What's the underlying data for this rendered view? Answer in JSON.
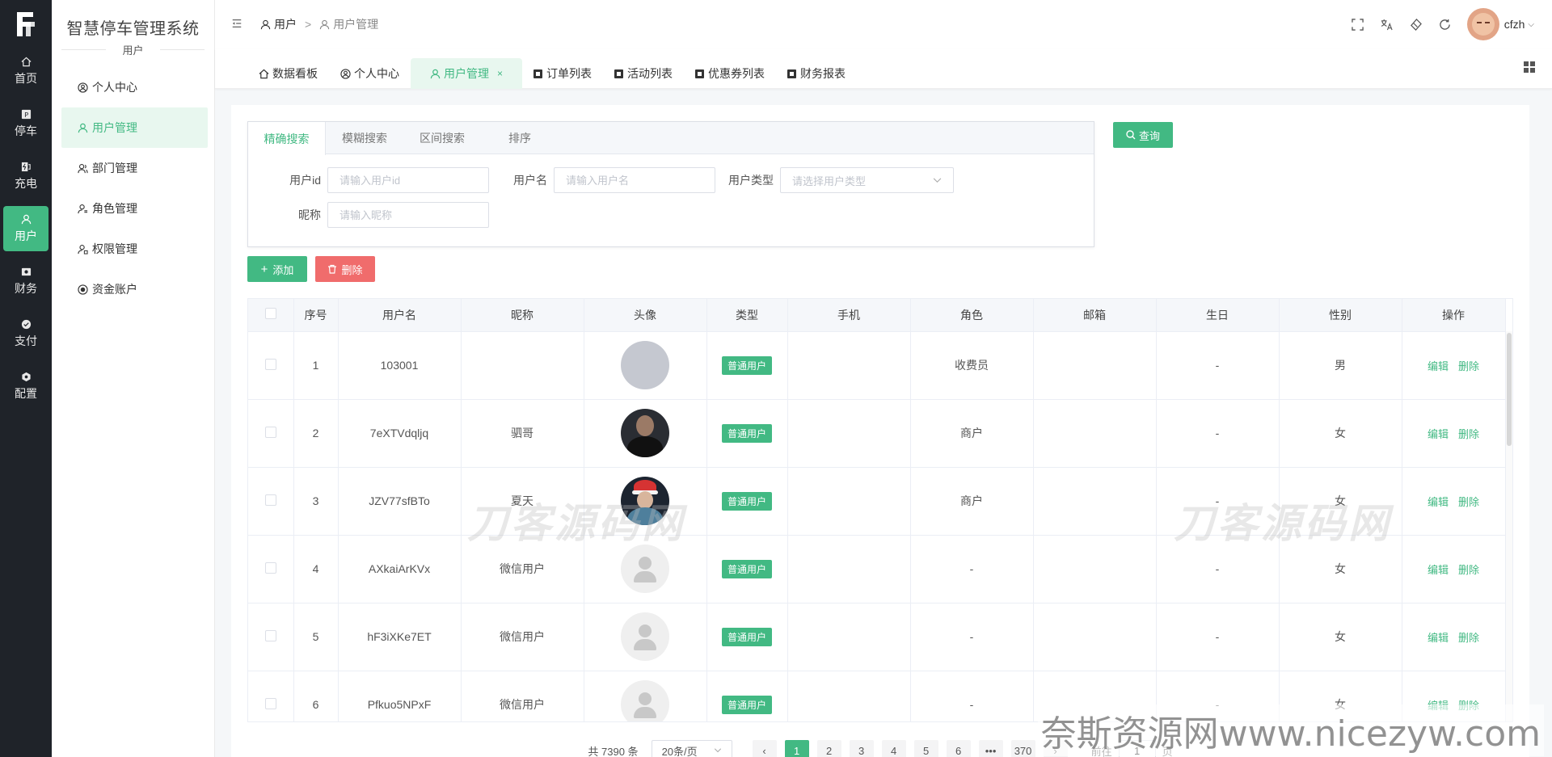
{
  "rail": {
    "items": [
      {
        "label": "首页",
        "icon": "home-icon"
      },
      {
        "label": "停车",
        "icon": "parking-icon"
      },
      {
        "label": "充电",
        "icon": "charge-icon"
      },
      {
        "label": "用户",
        "icon": "user-icon"
      },
      {
        "label": "财务",
        "icon": "finance-icon"
      },
      {
        "label": "支付",
        "icon": "pay-icon"
      },
      {
        "label": "配置",
        "icon": "config-icon"
      }
    ],
    "active": "用户"
  },
  "submenu": {
    "title": "智慧停车管理系统",
    "subtitle": "用户",
    "items": [
      {
        "label": "个人中心",
        "icon": "person-center-icon"
      },
      {
        "label": "用户管理",
        "icon": "user-icon"
      },
      {
        "label": "部门管理",
        "icon": "department-icon"
      },
      {
        "label": "角色管理",
        "icon": "role-icon"
      },
      {
        "label": "权限管理",
        "icon": "permission-icon"
      },
      {
        "label": "资金账户",
        "icon": "account-icon"
      }
    ],
    "active": "用户管理"
  },
  "breadcrumb": {
    "level1": "用户",
    "separator": ">",
    "level2": "用户管理"
  },
  "header": {
    "username": "cfzh"
  },
  "tabs": [
    {
      "label": "数据看板",
      "icon": "home-icon"
    },
    {
      "label": "个人中心",
      "icon": "person-center-icon"
    },
    {
      "label": "用户管理",
      "icon": "user-icon",
      "active": true,
      "close": "×"
    },
    {
      "label": "订单列表",
      "icon": "doc-icon"
    },
    {
      "label": "活动列表",
      "icon": "doc-icon"
    },
    {
      "label": "优惠券列表",
      "icon": "doc-icon"
    },
    {
      "label": "财务报表",
      "icon": "doc-icon"
    }
  ],
  "search": {
    "tabs": [
      "精确搜索",
      "模糊搜索",
      "区间搜索",
      "排序"
    ],
    "fields": {
      "user_id": {
        "label": "用户id",
        "placeholder": "请输入用户id",
        "value": ""
      },
      "username": {
        "label": "用户名",
        "placeholder": "请输入用户名",
        "value": ""
      },
      "user_type": {
        "label": "用户类型",
        "placeholder": "请选择用户类型"
      },
      "nickname": {
        "label": "昵称",
        "placeholder": "请输入昵称",
        "value": ""
      }
    },
    "query_label": "查询"
  },
  "actions": {
    "add_label": "添加",
    "delete_label": "删除"
  },
  "table": {
    "headers": [
      "",
      "序号",
      "用户名",
      "昵称",
      "头像",
      "类型",
      "手机",
      "角色",
      "邮箱",
      "生日",
      "性别",
      "操作"
    ],
    "edit_label": "编辑",
    "delete_label": "删除",
    "rows": [
      {
        "no": "1",
        "username": "103001",
        "nickname": "",
        "avatar": "grey",
        "type": "普通用户",
        "phone": "",
        "role": "收费员",
        "email": "",
        "birthday": "-",
        "gender": "男"
      },
      {
        "no": "2",
        "username": "7eXTVdqljq",
        "nickname": "驷哥",
        "avatar": "dark",
        "type": "普通用户",
        "phone": "",
        "role": "商户",
        "email": "",
        "birthday": "-",
        "gender": "女"
      },
      {
        "no": "3",
        "username": "JZV77sfBTo",
        "nickname": "夏天",
        "avatar": "xmas",
        "type": "普通用户",
        "phone": "",
        "role": "商户",
        "email": "",
        "birthday": "-",
        "gender": "女"
      },
      {
        "no": "4",
        "username": "AXkaiArKVx",
        "nickname": "微信用户",
        "avatar": "def",
        "type": "普通用户",
        "phone": "",
        "role": "-",
        "email": "",
        "birthday": "-",
        "gender": "女"
      },
      {
        "no": "5",
        "username": "hF3iXKe7ET",
        "nickname": "微信用户",
        "avatar": "def",
        "type": "普通用户",
        "phone": "",
        "role": "-",
        "email": "",
        "birthday": "-",
        "gender": "女"
      },
      {
        "no": "6",
        "username": "Pfkuo5NPxF",
        "nickname": "微信用户",
        "avatar": "def",
        "type": "普通用户",
        "phone": "",
        "role": "-",
        "email": "",
        "birthday": "-",
        "gender": "女"
      }
    ]
  },
  "pagination": {
    "total": "共 7390 条",
    "page_size": "20条/页",
    "pages": [
      "1",
      "2",
      "3",
      "4",
      "5",
      "6",
      "•••",
      "370"
    ],
    "current": "1",
    "goto_prefix": "前往",
    "goto_value": "1",
    "goto_suffix": "页"
  },
  "watermarks": {
    "center": "刀客源码网",
    "corner": "奈斯资源网www.nicezyw.com"
  },
  "colors": {
    "primary": "#42b983",
    "danger": "#f06c6c",
    "rail_bg": "#1f2329"
  }
}
